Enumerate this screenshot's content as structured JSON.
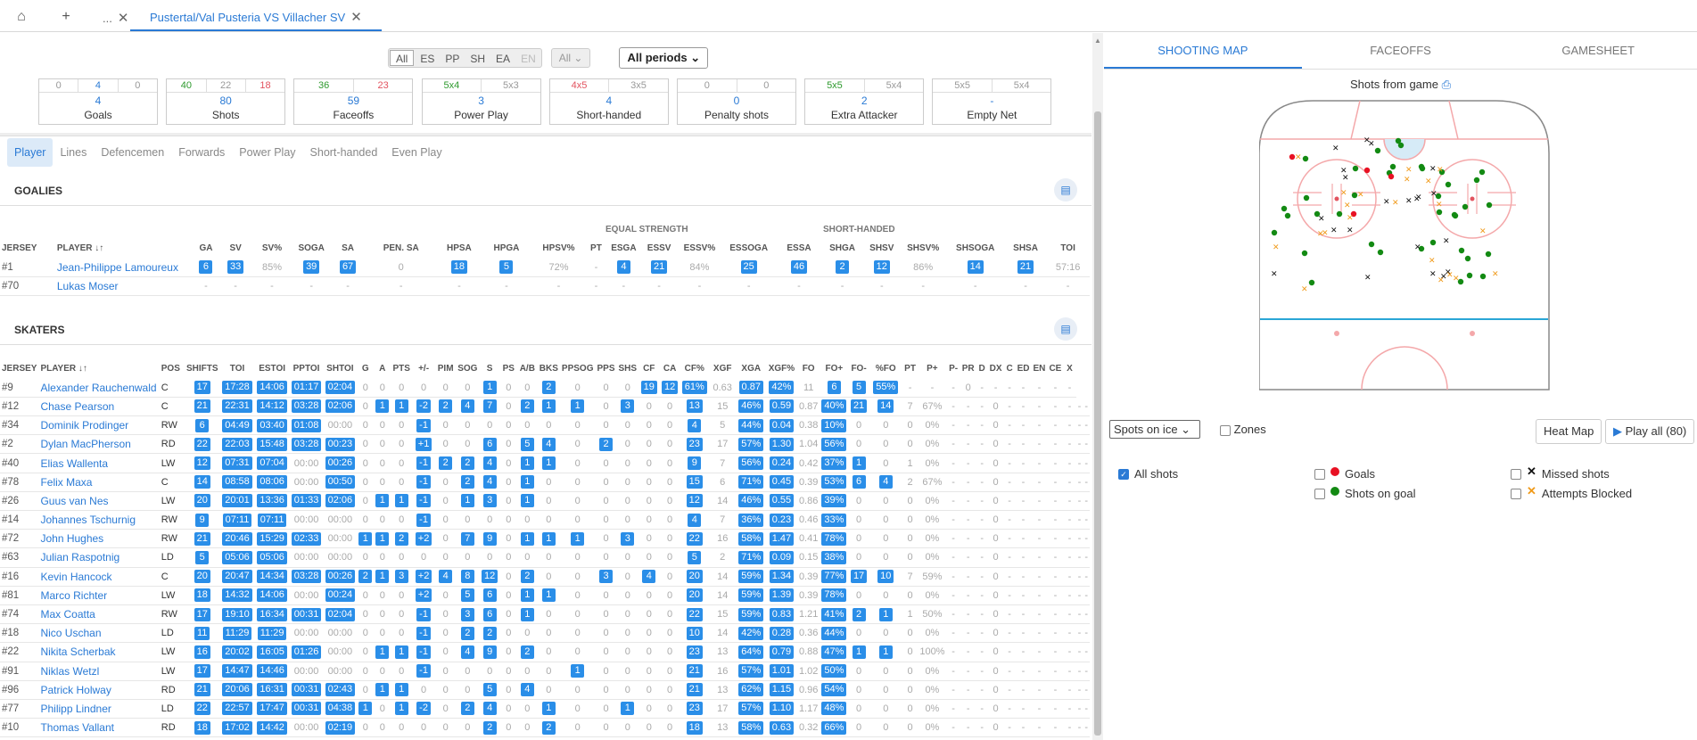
{
  "topbar": {
    "home_icon": "home-icon",
    "add_icon": "plus-icon",
    "tab1": "...",
    "tab2": "Pustertal/Val Pusteria VS Villacher SV"
  },
  "filters": {
    "strength": [
      "All",
      "ES",
      "PP",
      "SH",
      "EA",
      "EN"
    ],
    "strength_sel": "All",
    "team": "All",
    "periods": "All periods"
  },
  "stats": [
    {
      "label": "Goals",
      "value": "4",
      "top": [
        [
          "0",
          "gy"
        ],
        [
          "4",
          "b"
        ],
        [
          "0",
          "gy"
        ]
      ]
    },
    {
      "label": "Shots",
      "value": "80",
      "top": [
        [
          "40",
          "g"
        ],
        [
          "22",
          "gy"
        ],
        [
          "18",
          "r"
        ]
      ]
    },
    {
      "label": "Faceoffs",
      "value": "59",
      "top": [
        [
          "36",
          "g"
        ],
        [
          "23",
          "r"
        ]
      ]
    },
    {
      "label": "Power Play",
      "value": "3",
      "top": [
        [
          "5x4",
          "g"
        ],
        [
          "5x3",
          "gy"
        ]
      ]
    },
    {
      "label": "Short-handed",
      "value": "4",
      "top": [
        [
          "4x5",
          "r"
        ],
        [
          "3x5",
          "gy"
        ]
      ]
    },
    {
      "label": "Penalty shots",
      "value": "0",
      "top": [
        [
          "0",
          "gy"
        ],
        [
          "0",
          "gy"
        ]
      ]
    },
    {
      "label": "Extra Attacker",
      "value": "2",
      "top": [
        [
          "5x5",
          "g"
        ],
        [
          "5x4",
          "gy"
        ]
      ]
    },
    {
      "label": "Empty Net",
      "value": "-",
      "top": [
        [
          "5x5",
          "gy"
        ],
        [
          "5x4",
          "gy"
        ]
      ]
    }
  ],
  "subtabs": [
    "Player",
    "Lines",
    "Defencemen",
    "Forwards",
    "Power Play",
    "Short-handed",
    "Even Play"
  ],
  "goalies": {
    "title": "GOALIES",
    "group1": "EQUAL STRENGTH",
    "group2": "SHORT-HANDED",
    "headers": [
      "JERSEY",
      "PLAYER ↓↑",
      "GA",
      "SV",
      "SV%",
      "SOGA",
      "SA",
      "PEN. SA",
      "HPSA",
      "HPGA",
      "HPSV%",
      "PT",
      "ESGA",
      "ESSV",
      "ESSV%",
      "ESSOGA",
      "ESSA",
      "SHGA",
      "SHSV",
      "SHSV%",
      "SHSOGA",
      "SHSA",
      "TOI"
    ],
    "rows": [
      {
        "jersey": "#1",
        "name": "Jean-Philippe Lamoureux",
        "cells": [
          "6",
          "33",
          "85%",
          "39",
          "67",
          "0",
          "18",
          "5",
          "72%",
          "-",
          "4",
          "21",
          "84%",
          "25",
          "46",
          "2",
          "12",
          "86%",
          "14",
          "21",
          "57:16"
        ]
      },
      {
        "jersey": "#70",
        "name": "Lukas Moser",
        "cells": [
          "-",
          "-",
          "-",
          "-",
          "-",
          "-",
          "-",
          "-",
          "-",
          "-",
          "-",
          "-",
          "-",
          "-",
          "-",
          "-",
          "-",
          "-",
          "-",
          "-",
          "-"
        ]
      }
    ]
  },
  "skaters": {
    "title": "SKATERS",
    "headers": [
      "JERSEY",
      "PLAYER ↓↑",
      "POS",
      "SHIFTS",
      "TOI",
      "ESTOI",
      "PPTOI",
      "SHTOI",
      "G",
      "A",
      "PTS",
      "+/-",
      "PIM",
      "SOG",
      "S",
      "PS",
      "A/B",
      "BKS",
      "PPSOG",
      "PPS",
      "SHS",
      "CF",
      "CA",
      "CF%",
      "XGF",
      "XGA",
      "XGF%",
      "FO",
      "FO+",
      "FO-",
      "%FO",
      "PT",
      "P+",
      "P-",
      "PR",
      "D",
      "DX",
      "C",
      "ED",
      "EN",
      "CE",
      "X"
    ],
    "rows": [
      {
        "jersey": "#9",
        "name": "Alexander Rauchenwald",
        "cells": [
          "C",
          "17",
          "17:28",
          "14:06",
          "01:17",
          "02:04",
          "0",
          "0",
          "0",
          "0",
          "0",
          "0",
          "1",
          "0",
          "0",
          "2",
          "0",
          "0",
          "0",
          "19",
          "12",
          "61%",
          "0.63",
          "0.87",
          "42%",
          "11",
          "6",
          "5",
          "55%",
          "-",
          "-",
          "-",
          "0",
          "-",
          "-",
          "-",
          "-",
          "-",
          "-",
          "-"
        ]
      },
      {
        "jersey": "#12",
        "name": "Chase Pearson",
        "cells": [
          "C",
          "21",
          "22:31",
          "14:12",
          "03:28",
          "02:06",
          "0",
          "1",
          "1",
          "-2",
          "2",
          "4",
          "7",
          "0",
          "2",
          "1",
          "1",
          "0",
          "3",
          "0",
          "0",
          "13",
          "15",
          "46%",
          "0.59",
          "0.87",
          "40%",
          "21",
          "14",
          "7",
          "67%",
          "-",
          "-",
          "-",
          "0",
          "-",
          "-",
          "-",
          "-",
          "-",
          "-",
          "-"
        ]
      },
      {
        "jersey": "#34",
        "name": "Dominik Prodinger",
        "cells": [
          "RW",
          "6",
          "04:49",
          "03:40",
          "01:08",
          "00:00",
          "0",
          "0",
          "0",
          "-1",
          "0",
          "0",
          "0",
          "0",
          "0",
          "0",
          "0",
          "0",
          "0",
          "0",
          "0",
          "4",
          "5",
          "44%",
          "0.04",
          "0.38",
          "10%",
          "0",
          "0",
          "0",
          "0%",
          "-",
          "-",
          "-",
          "0",
          "-",
          "-",
          "-",
          "-",
          "-",
          "-",
          "-"
        ]
      },
      {
        "jersey": "#2",
        "name": "Dylan MacPherson",
        "cells": [
          "RD",
          "22",
          "22:03",
          "15:48",
          "03:28",
          "00:23",
          "0",
          "0",
          "0",
          "+1",
          "0",
          "0",
          "6",
          "0",
          "5",
          "4",
          "0",
          "2",
          "0",
          "0",
          "0",
          "23",
          "17",
          "57%",
          "1.30",
          "1.04",
          "56%",
          "0",
          "0",
          "0",
          "0%",
          "-",
          "-",
          "-",
          "0",
          "-",
          "-",
          "-",
          "-",
          "-",
          "-",
          "-"
        ]
      },
      {
        "jersey": "#40",
        "name": "Elias Wallenta",
        "cells": [
          "LW",
          "12",
          "07:31",
          "07:04",
          "00:00",
          "00:26",
          "0",
          "0",
          "0",
          "-1",
          "2",
          "2",
          "4",
          "0",
          "1",
          "1",
          "0",
          "0",
          "0",
          "0",
          "0",
          "9",
          "7",
          "56%",
          "0.24",
          "0.42",
          "37%",
          "1",
          "0",
          "1",
          "0%",
          "-",
          "-",
          "-",
          "0",
          "-",
          "-",
          "-",
          "-",
          "-",
          "-",
          "-"
        ]
      },
      {
        "jersey": "#78",
        "name": "Felix Maxa",
        "cells": [
          "C",
          "14",
          "08:58",
          "08:06",
          "00:00",
          "00:50",
          "0",
          "0",
          "0",
          "-1",
          "0",
          "2",
          "4",
          "0",
          "1",
          "0",
          "0",
          "0",
          "0",
          "0",
          "0",
          "15",
          "6",
          "71%",
          "0.45",
          "0.39",
          "53%",
          "6",
          "4",
          "2",
          "67%",
          "-",
          "-",
          "-",
          "0",
          "-",
          "-",
          "-",
          "-",
          "-",
          "-",
          "-"
        ]
      },
      {
        "jersey": "#26",
        "name": "Guus van Nes",
        "cells": [
          "LW",
          "20",
          "20:01",
          "13:36",
          "01:33",
          "02:06",
          "0",
          "1",
          "1",
          "-1",
          "0",
          "1",
          "3",
          "0",
          "1",
          "0",
          "0",
          "0",
          "0",
          "0",
          "0",
          "12",
          "14",
          "46%",
          "0.55",
          "0.86",
          "39%",
          "0",
          "0",
          "0",
          "0%",
          "-",
          "-",
          "-",
          "0",
          "-",
          "-",
          "-",
          "-",
          "-",
          "-",
          "-"
        ]
      },
      {
        "jersey": "#14",
        "name": "Johannes Tschurnig",
        "cells": [
          "RW",
          "9",
          "07:11",
          "07:11",
          "00:00",
          "00:00",
          "0",
          "0",
          "0",
          "-1",
          "0",
          "0",
          "0",
          "0",
          "0",
          "0",
          "0",
          "0",
          "0",
          "0",
          "0",
          "4",
          "7",
          "36%",
          "0.23",
          "0.46",
          "33%",
          "0",
          "0",
          "0",
          "0%",
          "-",
          "-",
          "-",
          "0",
          "-",
          "-",
          "-",
          "-",
          "-",
          "-",
          "-"
        ]
      },
      {
        "jersey": "#72",
        "name": "John Hughes",
        "cells": [
          "RW",
          "21",
          "20:46",
          "15:29",
          "02:33",
          "00:00",
          "1",
          "1",
          "2",
          "+2",
          "0",
          "7",
          "9",
          "0",
          "1",
          "1",
          "1",
          "0",
          "3",
          "0",
          "0",
          "22",
          "16",
          "58%",
          "1.47",
          "0.41",
          "78%",
          "0",
          "0",
          "0",
          "0%",
          "-",
          "-",
          "-",
          "0",
          "-",
          "-",
          "-",
          "-",
          "-",
          "-",
          "-"
        ]
      },
      {
        "jersey": "#63",
        "name": "Julian Raspotnig",
        "cells": [
          "LD",
          "5",
          "05:06",
          "05:06",
          "00:00",
          "00:00",
          "0",
          "0",
          "0",
          "0",
          "0",
          "0",
          "0",
          "0",
          "0",
          "0",
          "0",
          "0",
          "0",
          "0",
          "0",
          "5",
          "2",
          "71%",
          "0.09",
          "0.15",
          "38%",
          "0",
          "0",
          "0",
          "0%",
          "-",
          "-",
          "-",
          "0",
          "-",
          "-",
          "-",
          "-",
          "-",
          "-",
          "-"
        ]
      },
      {
        "jersey": "#16",
        "name": "Kevin Hancock",
        "cells": [
          "C",
          "20",
          "20:47",
          "14:34",
          "03:28",
          "00:26",
          "2",
          "1",
          "3",
          "+2",
          "4",
          "8",
          "12",
          "0",
          "2",
          "0",
          "0",
          "3",
          "0",
          "4",
          "0",
          "20",
          "14",
          "59%",
          "1.34",
          "0.39",
          "77%",
          "17",
          "10",
          "7",
          "59%",
          "-",
          "-",
          "-",
          "0",
          "-",
          "-",
          "-",
          "-",
          "-",
          "-",
          "-"
        ]
      },
      {
        "jersey": "#81",
        "name": "Marco Richter",
        "cells": [
          "LW",
          "18",
          "14:32",
          "14:06",
          "00:00",
          "00:24",
          "0",
          "0",
          "0",
          "+2",
          "0",
          "5",
          "6",
          "0",
          "1",
          "1",
          "0",
          "0",
          "0",
          "0",
          "0",
          "20",
          "14",
          "59%",
          "1.39",
          "0.39",
          "78%",
          "0",
          "0",
          "0",
          "0%",
          "-",
          "-",
          "-",
          "0",
          "-",
          "-",
          "-",
          "-",
          "-",
          "-",
          "-"
        ]
      },
      {
        "jersey": "#74",
        "name": "Max Coatta",
        "cells": [
          "RW",
          "17",
          "19:10",
          "16:34",
          "00:31",
          "02:04",
          "0",
          "0",
          "0",
          "-1",
          "0",
          "3",
          "6",
          "0",
          "1",
          "0",
          "0",
          "0",
          "0",
          "0",
          "0",
          "22",
          "15",
          "59%",
          "0.83",
          "1.21",
          "41%",
          "2",
          "1",
          "1",
          "50%",
          "-",
          "-",
          "-",
          "0",
          "-",
          "-",
          "-",
          "-",
          "-",
          "-",
          "-"
        ]
      },
      {
        "jersey": "#18",
        "name": "Nico Uschan",
        "cells": [
          "LD",
          "11",
          "11:29",
          "11:29",
          "00:00",
          "00:00",
          "0",
          "0",
          "0",
          "-1",
          "0",
          "2",
          "2",
          "0",
          "0",
          "0",
          "0",
          "0",
          "0",
          "0",
          "0",
          "10",
          "14",
          "42%",
          "0.28",
          "0.36",
          "44%",
          "0",
          "0",
          "0",
          "0%",
          "-",
          "-",
          "-",
          "0",
          "-",
          "-",
          "-",
          "-",
          "-",
          "-",
          "-"
        ]
      },
      {
        "jersey": "#22",
        "name": "Nikita Scherbak",
        "cells": [
          "LW",
          "16",
          "20:02",
          "16:05",
          "01:26",
          "00:00",
          "0",
          "1",
          "1",
          "-1",
          "0",
          "4",
          "9",
          "0",
          "2",
          "0",
          "0",
          "0",
          "0",
          "0",
          "0",
          "23",
          "13",
          "64%",
          "0.79",
          "0.88",
          "47%",
          "1",
          "1",
          "0",
          "100%",
          "-",
          "-",
          "-",
          "0",
          "-",
          "-",
          "-",
          "-",
          "-",
          "-",
          "-"
        ]
      },
      {
        "jersey": "#91",
        "name": "Niklas Wetzl",
        "cells": [
          "LW",
          "17",
          "14:47",
          "14:46",
          "00:00",
          "00:00",
          "0",
          "0",
          "0",
          "-1",
          "0",
          "0",
          "0",
          "0",
          "0",
          "0",
          "1",
          "0",
          "0",
          "0",
          "0",
          "21",
          "16",
          "57%",
          "1.01",
          "1.02",
          "50%",
          "0",
          "0",
          "0",
          "0%",
          "-",
          "-",
          "-",
          "0",
          "-",
          "-",
          "-",
          "-",
          "-",
          "-",
          "-"
        ]
      },
      {
        "jersey": "#96",
        "name": "Patrick Holway",
        "cells": [
          "RD",
          "21",
          "20:06",
          "16:31",
          "00:31",
          "02:43",
          "0",
          "1",
          "1",
          "0",
          "0",
          "0",
          "5",
          "0",
          "4",
          "0",
          "0",
          "0",
          "0",
          "0",
          "0",
          "21",
          "13",
          "62%",
          "1.15",
          "0.96",
          "54%",
          "0",
          "0",
          "0",
          "0%",
          "-",
          "-",
          "-",
          "0",
          "-",
          "-",
          "-",
          "-",
          "-",
          "-",
          "-"
        ]
      },
      {
        "jersey": "#77",
        "name": "Philipp Lindner",
        "cells": [
          "LD",
          "22",
          "22:57",
          "17:47",
          "00:31",
          "04:38",
          "1",
          "0",
          "1",
          "-2",
          "0",
          "2",
          "4",
          "0",
          "0",
          "1",
          "0",
          "0",
          "1",
          "0",
          "0",
          "23",
          "17",
          "57%",
          "1.10",
          "1.17",
          "48%",
          "0",
          "0",
          "0",
          "0%",
          "-",
          "-",
          "-",
          "0",
          "-",
          "-",
          "-",
          "-",
          "-",
          "-",
          "-"
        ]
      },
      {
        "jersey": "#10",
        "name": "Thomas Vallant",
        "cells": [
          "RD",
          "18",
          "17:02",
          "14:42",
          "00:00",
          "02:19",
          "0",
          "0",
          "0",
          "0",
          "0",
          "0",
          "2",
          "0",
          "0",
          "2",
          "0",
          "0",
          "0",
          "0",
          "0",
          "18",
          "13",
          "58%",
          "0.63",
          "0.32",
          "66%",
          "0",
          "0",
          "0",
          "0%",
          "-",
          "-",
          "-",
          "0",
          "-",
          "-",
          "-",
          "-",
          "-",
          "-",
          "-"
        ]
      }
    ]
  },
  "right": {
    "tabs": [
      "SHOOTING MAP",
      "FACEOFFS",
      "GAMESHEET"
    ],
    "shots_title": "Shots from game",
    "spots_select": "Spots on ice",
    "zones": "Zones",
    "heat_map": "Heat Map",
    "play_all": "Play all (80)",
    "all_shots": "All shots",
    "goals": "Goals",
    "shots_on_goal": "Shots on goal",
    "missed": "Missed shots",
    "blocked": "Attempts Blocked"
  }
}
